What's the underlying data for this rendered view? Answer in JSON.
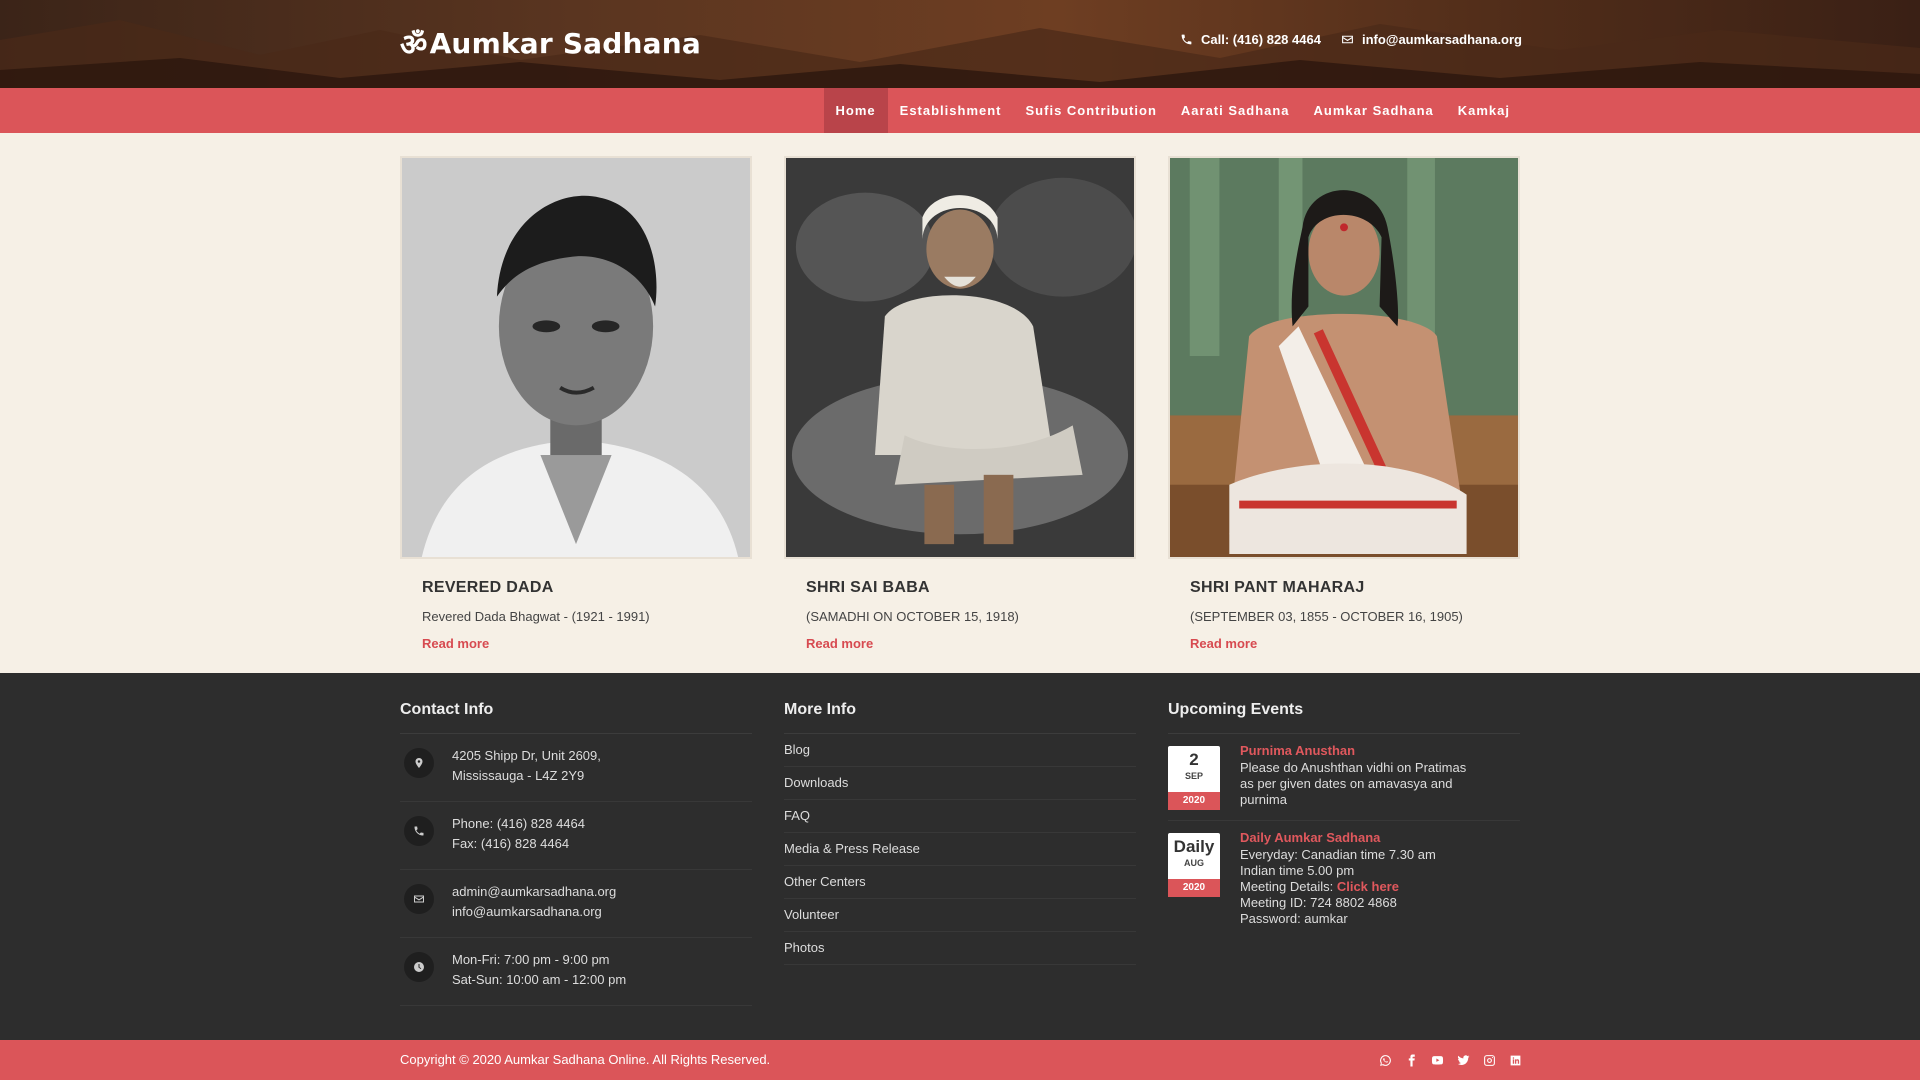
{
  "header": {
    "logo_symbol": "ॐ",
    "logo_text": "Aumkar Sadhana",
    "phone_label": "Call: (416) 828 4464",
    "email_label": "info@aumkarsadhana.org"
  },
  "nav": {
    "items": [
      {
        "label": "Home",
        "active": true
      },
      {
        "label": "Establishment"
      },
      {
        "label": "Sufis Contribution"
      },
      {
        "label": "Aarati Sadhana"
      },
      {
        "label": "Aumkar Sadhana"
      },
      {
        "label": "Kamkaj"
      }
    ]
  },
  "cards": [
    {
      "name": "REVERED DADA",
      "desc": "Revered Dada Bhagwat - (1921 - 1991)",
      "more": "Read more"
    },
    {
      "name": "SHRI SAI BABA",
      "desc": "(SAMADHI ON OCTOBER 15, 1918)",
      "more": "Read more"
    },
    {
      "name": "SHRI PANT MAHARAJ",
      "desc": "(SEPTEMBER 03, 1855 - OCTOBER 16, 1905)",
      "more": "Read more"
    }
  ],
  "footer": {
    "contact": {
      "heading": "Contact Info",
      "address_1": "4205 Shipp Dr, Unit 2609,",
      "address_2": "Mississauga - L4Z 2Y9",
      "phone": "Phone: (416) 828 4464",
      "fax": "Fax: (416) 828 4464",
      "email_1": "admin@aumkarsadhana.org",
      "email_2": "info@aumkarsadhana.org",
      "hours_1": "Mon-Fri: 7:00 pm - 9:00 pm",
      "hours_2": "Sat-Sun: 10:00 am - 12:00 pm"
    },
    "more_info": {
      "heading": "More Info",
      "links": [
        "Blog",
        "Downloads",
        "FAQ",
        "Media & Press Release",
        "Other Centers",
        "Volunteer",
        "Photos"
      ]
    },
    "events": {
      "heading": "Upcoming Events",
      "items": [
        {
          "day": "2",
          "month": "SEP",
          "year": "2020",
          "title": "Purnima Anusthan",
          "line_1": "Please do Anushthan vidhi on Pratimas",
          "line_2": "as per given dates on amavasya and",
          "line_3": "purnima"
        },
        {
          "day": "Daily",
          "month": "AUG",
          "year": "2020",
          "title": "Daily Aumkar Sadhana",
          "line_1": "Everyday: Canadian time 7.30 am",
          "line_2": "Indian time 5.00 pm",
          "line_3_prefix": "Meeting Details: ",
          "line_3_link": "Click here",
          "line_4": "Meeting ID: 724 8802 4868",
          "line_5": "Password: aumkar"
        }
      ]
    }
  },
  "bottom": {
    "copyright": "Copyright © 2020 Aumkar Sadhana Online. All Rights Reserved.",
    "socials": [
      "whatsapp-icon",
      "facebook-icon",
      "youtube-icon",
      "twitter-icon",
      "instagram-icon",
      "linkedin-icon"
    ]
  },
  "colors": {
    "accent": "#db5559",
    "footer_bg": "#2d2d2d",
    "page_bg": "#f6f0e6"
  }
}
